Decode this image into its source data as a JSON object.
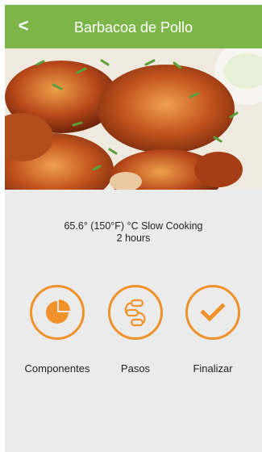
{
  "header": {
    "back_label": "<",
    "title": "Barbacoa de Pollo",
    "color": "#7db648"
  },
  "recipe": {
    "temperature_line": "65.6° (150°F) °C Slow Cooking",
    "duration": "2 hours"
  },
  "actions": [
    {
      "label": "Componentes",
      "icon": "pie-chart-icon"
    },
    {
      "label": "Pasos",
      "icon": "steps-path-icon"
    },
    {
      "label": "Finalizar",
      "icon": "checkmark-icon"
    }
  ],
  "colors": {
    "accent": "#f0922c",
    "panel_bg": "#ebebeb"
  }
}
